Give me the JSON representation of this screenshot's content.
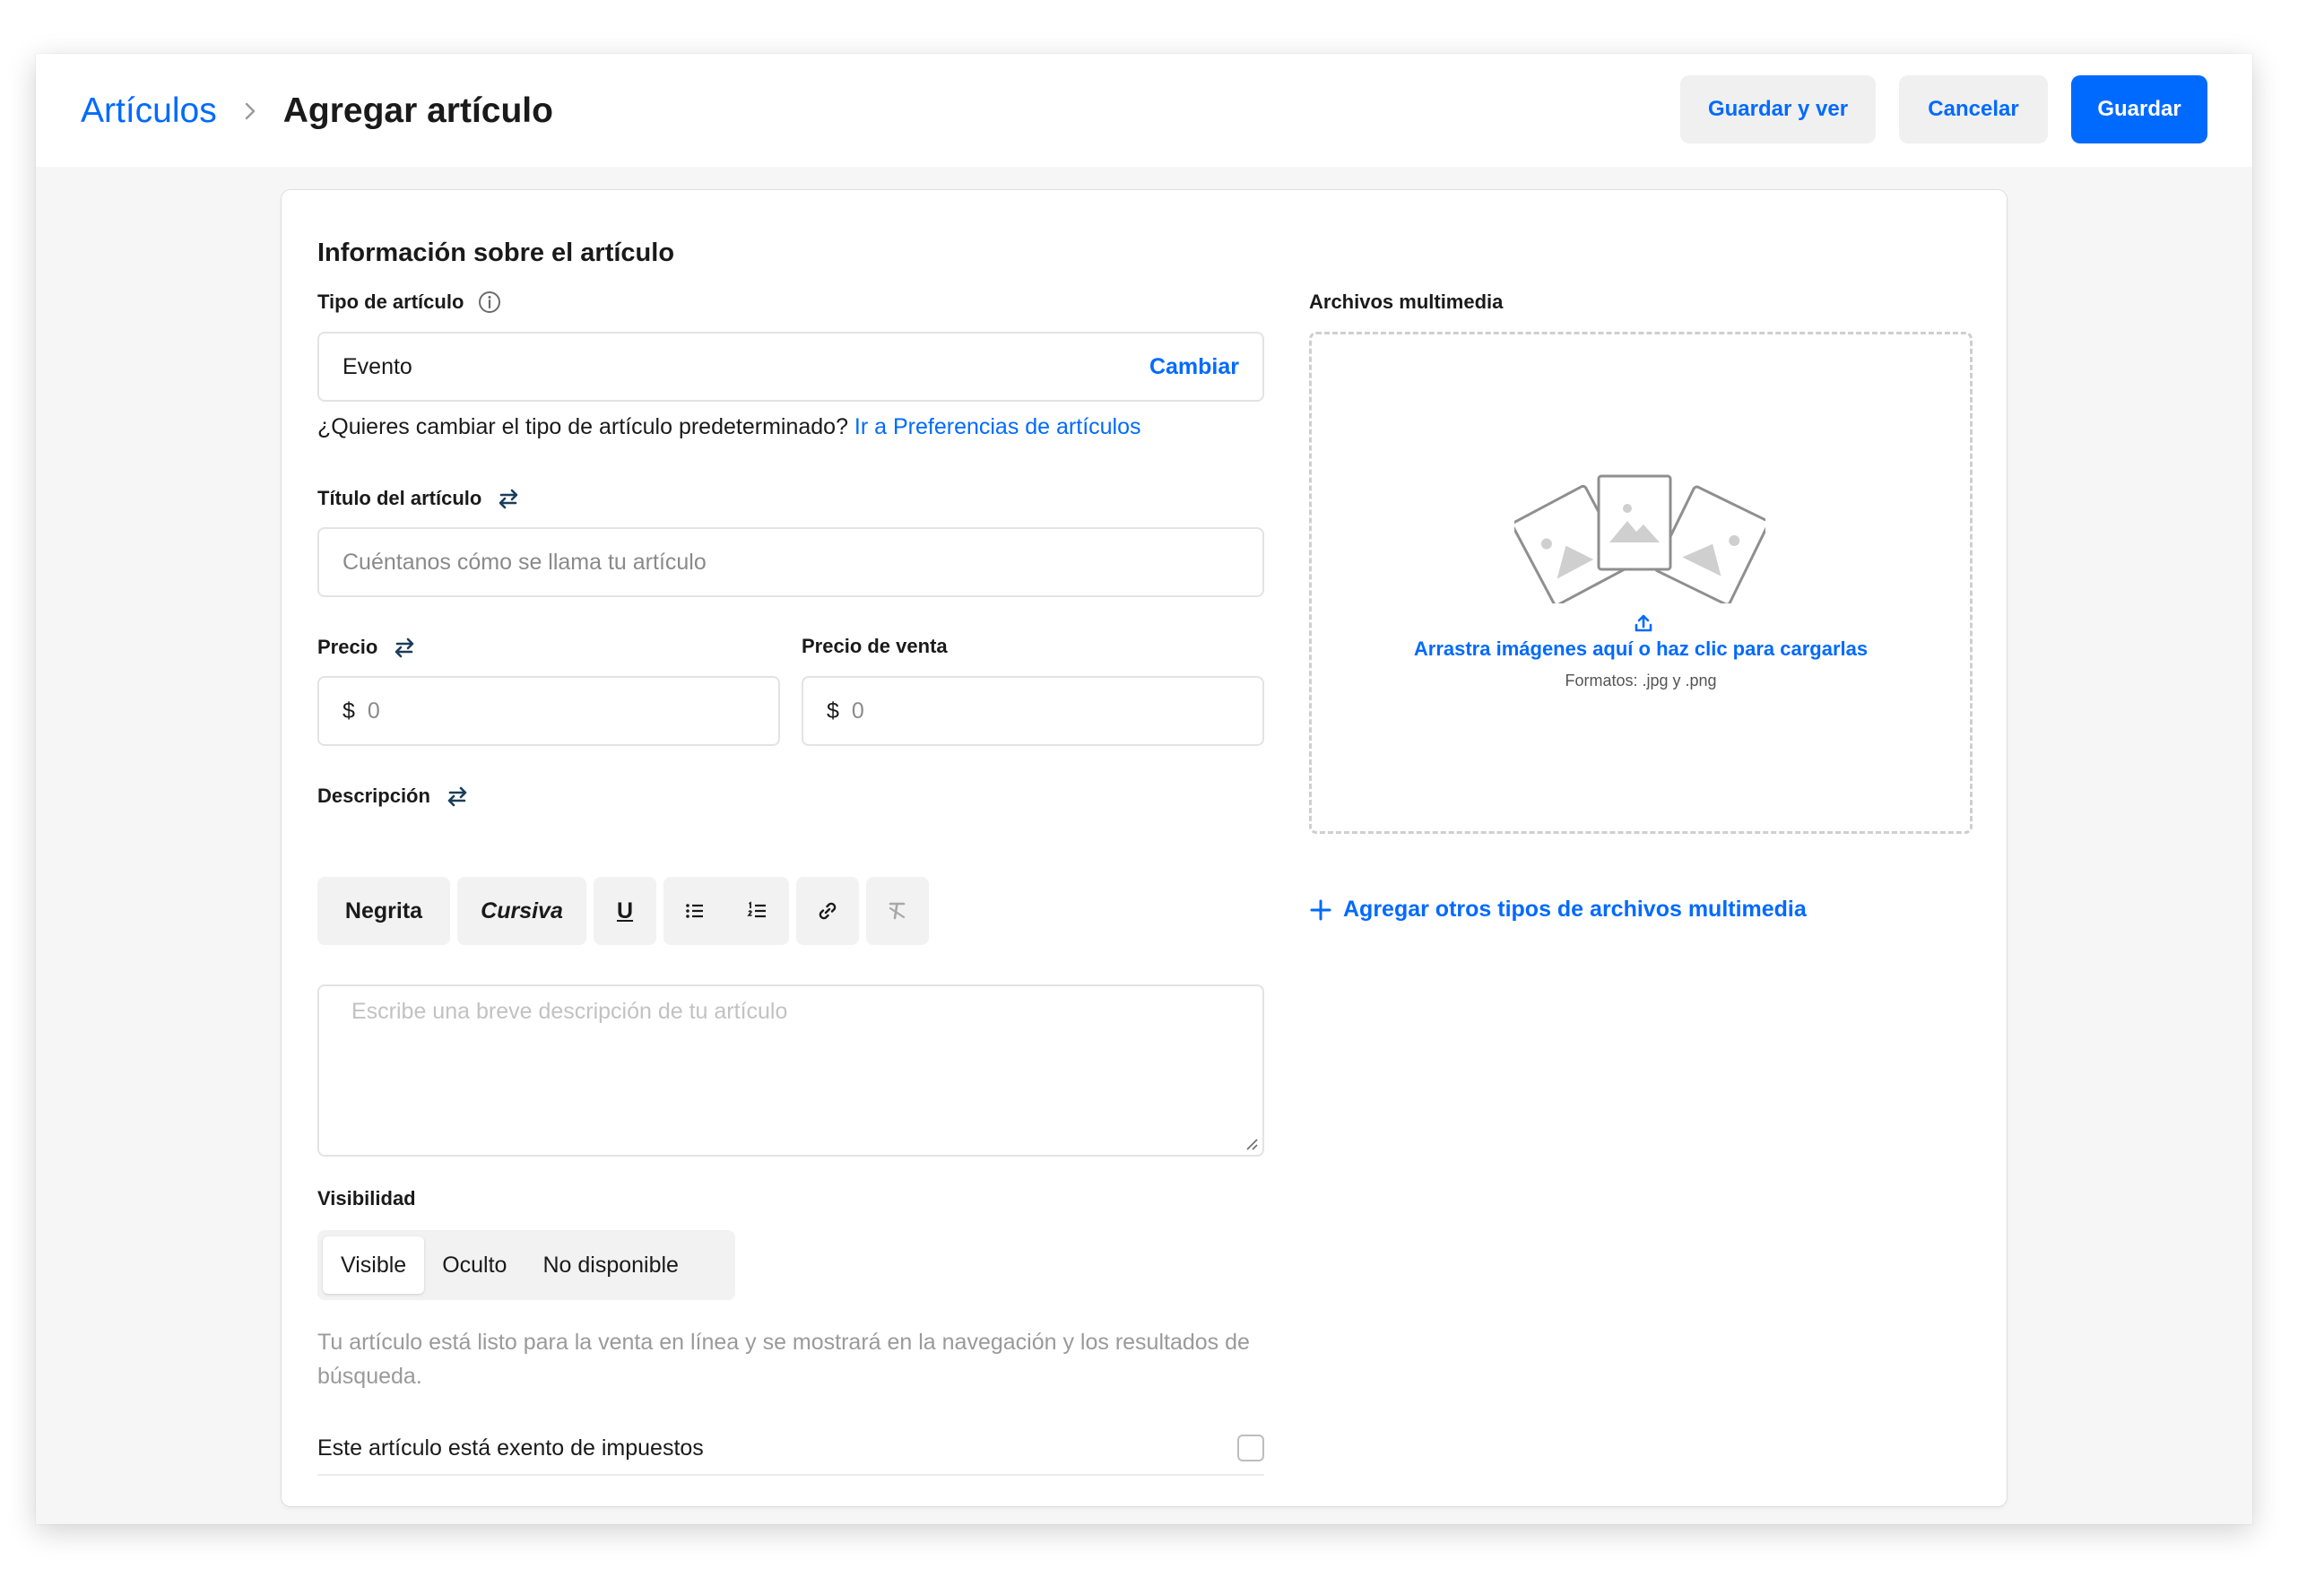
{
  "breadcrumb": {
    "parent": "Artículos",
    "current": "Agregar artículo"
  },
  "actions": {
    "save_view": "Guardar y ver",
    "cancel": "Cancelar",
    "save": "Guardar"
  },
  "form": {
    "section_title": "Información sobre el artículo",
    "item_type": {
      "label": "Tipo de artículo",
      "value": "Evento",
      "change": "Cambiar",
      "helper_text": "¿Quieres cambiar el tipo de artículo predeterminado?",
      "helper_link": "Ir a Preferencias de artículos"
    },
    "title": {
      "label": "Título del artículo",
      "placeholder": "Cuéntanos cómo se llama tu artículo"
    },
    "price": {
      "label": "Precio",
      "currency": "$",
      "placeholder": "0"
    },
    "sale_price": {
      "label": "Precio de venta",
      "currency": "$",
      "placeholder": "0"
    },
    "description": {
      "label": "Descripción",
      "bold": "Negrita",
      "italic": "Cursiva",
      "underline": "U",
      "placeholder": "Escribe una breve descripción de tu artículo"
    },
    "visibility": {
      "label": "Visibilidad",
      "options": [
        "Visible",
        "Oculto",
        "No disponible"
      ],
      "selected": "Visible",
      "hint": "Tu artículo está listo para la venta en línea y se mostrará en la navegación y los resultados de búsqueda."
    },
    "tax_exempt": {
      "label": "Este artículo está exento de impuestos",
      "checked": false
    }
  },
  "media": {
    "label": "Archivos multimedia",
    "drop_text": "Arrastra imágenes aquí o haz clic para cargarlas",
    "formats": "Formatos: .jpg y .png",
    "add_other": "Agregar otros tipos de archivos multimedia"
  },
  "colors": {
    "accent": "#006aff",
    "text": "#1a1a1a",
    "muted": "#9a9a9a",
    "border": "#e3e3e3"
  }
}
